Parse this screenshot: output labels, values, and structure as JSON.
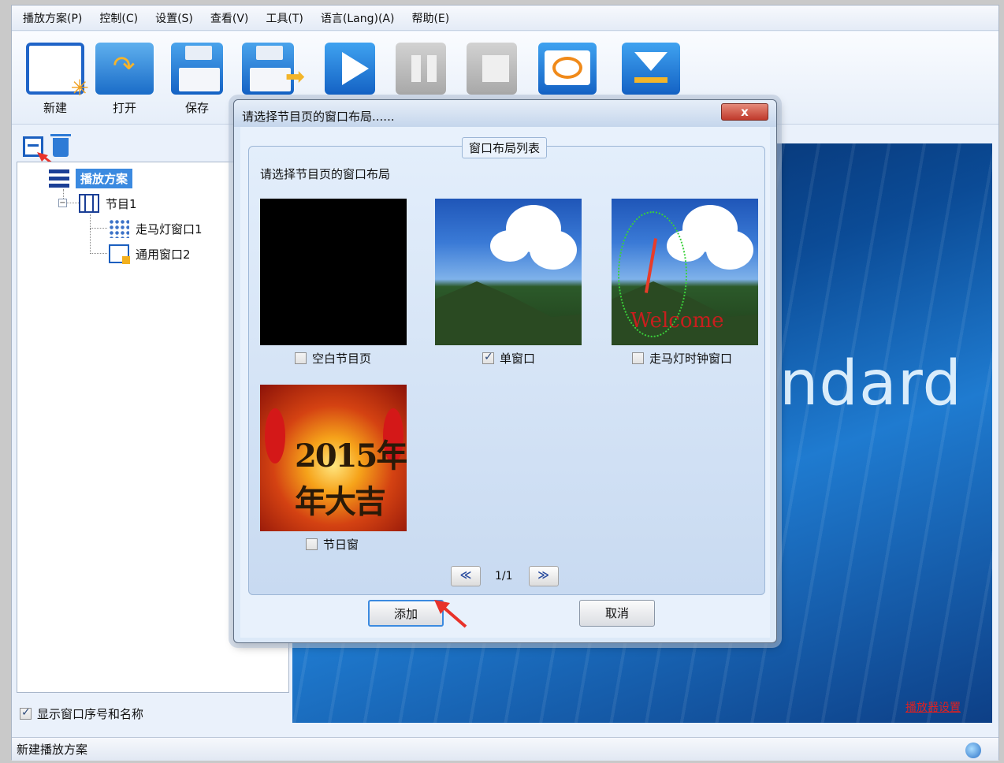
{
  "menu": [
    "播放方案(P)",
    "控制(C)",
    "设置(S)",
    "查看(V)",
    "工具(T)",
    "语言(Lang)(A)",
    "帮助(E)"
  ],
  "toolbar": {
    "new_label": "新建",
    "open_label": "打开",
    "save_label": "保存"
  },
  "tree": {
    "root": "播放方案",
    "program": "节目1",
    "child1": "走马灯窗口1",
    "child2": "通用窗口2"
  },
  "show_window_index_label": "显示窗口序号和名称",
  "preview": {
    "brand_partial": "ndard",
    "link": "播放器设置"
  },
  "status_text": "新建播放方案",
  "dialog": {
    "title": "请选择节目页的窗口布局......",
    "close": "x",
    "group_title": "窗口布局列表",
    "prompt": "请选择节目页的窗口布局",
    "layouts": [
      {
        "label": "空白节目页",
        "checked": false
      },
      {
        "label": "单窗口",
        "checked": true
      },
      {
        "label": "走马灯时钟窗口",
        "checked": false
      },
      {
        "label": "节日窗",
        "checked": false
      }
    ],
    "pager": {
      "prev": "≪",
      "page": "1/1",
      "next": "≫"
    },
    "add_button": "添加",
    "cancel_button": "取消"
  },
  "thumb_text": {
    "welcome": "Welcome",
    "festival": "2015年年大吉"
  },
  "colors": {
    "accent": "#3b8ae0",
    "arrow": "#e8322a"
  }
}
